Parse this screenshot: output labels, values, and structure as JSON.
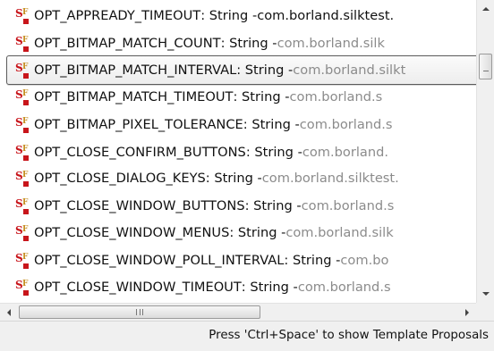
{
  "items": [
    {
      "name": "OPT_APPREADY_TIMEOUT",
      "sep": " : String - ",
      "qualifier": "com.borland.silktest.",
      "qualifier_dark": true
    },
    {
      "name": "OPT_BITMAP_MATCH_COUNT",
      "sep": " : String - ",
      "qualifier": "com.borland.silk"
    },
    {
      "name": "OPT_BITMAP_MATCH_INTERVAL",
      "sep": " : String - ",
      "qualifier": "com.borland.silkt",
      "selected": true
    },
    {
      "name": "OPT_BITMAP_MATCH_TIMEOUT",
      "sep": " : String - ",
      "qualifier": "com.borland.s"
    },
    {
      "name": "OPT_BITMAP_PIXEL_TOLERANCE",
      "sep": " : String - ",
      "qualifier": "com.borland.s"
    },
    {
      "name": "OPT_CLOSE_CONFIRM_BUTTONS",
      "sep": " : String - ",
      "qualifier": "com.borland."
    },
    {
      "name": "OPT_CLOSE_DIALOG_KEYS",
      "sep": " : String - ",
      "qualifier": "com.borland.silktest."
    },
    {
      "name": "OPT_CLOSE_WINDOW_BUTTONS",
      "sep": " : String - ",
      "qualifier": "com.borland.s"
    },
    {
      "name": "OPT_CLOSE_WINDOW_MENUS",
      "sep": " : String - ",
      "qualifier": "com.borland.silk"
    },
    {
      "name": "OPT_CLOSE_WINDOW_POLL_INTERVAL",
      "sep": " : String - ",
      "qualifier": "com.bo"
    },
    {
      "name": "OPT_CLOSE_WINDOW_TIMEOUT",
      "sep": " : String - ",
      "qualifier": "com.borland.s"
    }
  ],
  "status": {
    "text": "Press 'Ctrl+Space' to show Template Proposals"
  },
  "icons": {
    "field": "static-field-icon",
    "scroll_up": "arrow-up-icon",
    "scroll_down": "arrow-down-icon",
    "scroll_left": "arrow-left-icon",
    "scroll_right": "arrow-right-icon"
  },
  "colors": {
    "icon_red": "#c8151b",
    "icon_gold": "#c58d1e",
    "qualifier_gray": "#8b8b8b"
  }
}
